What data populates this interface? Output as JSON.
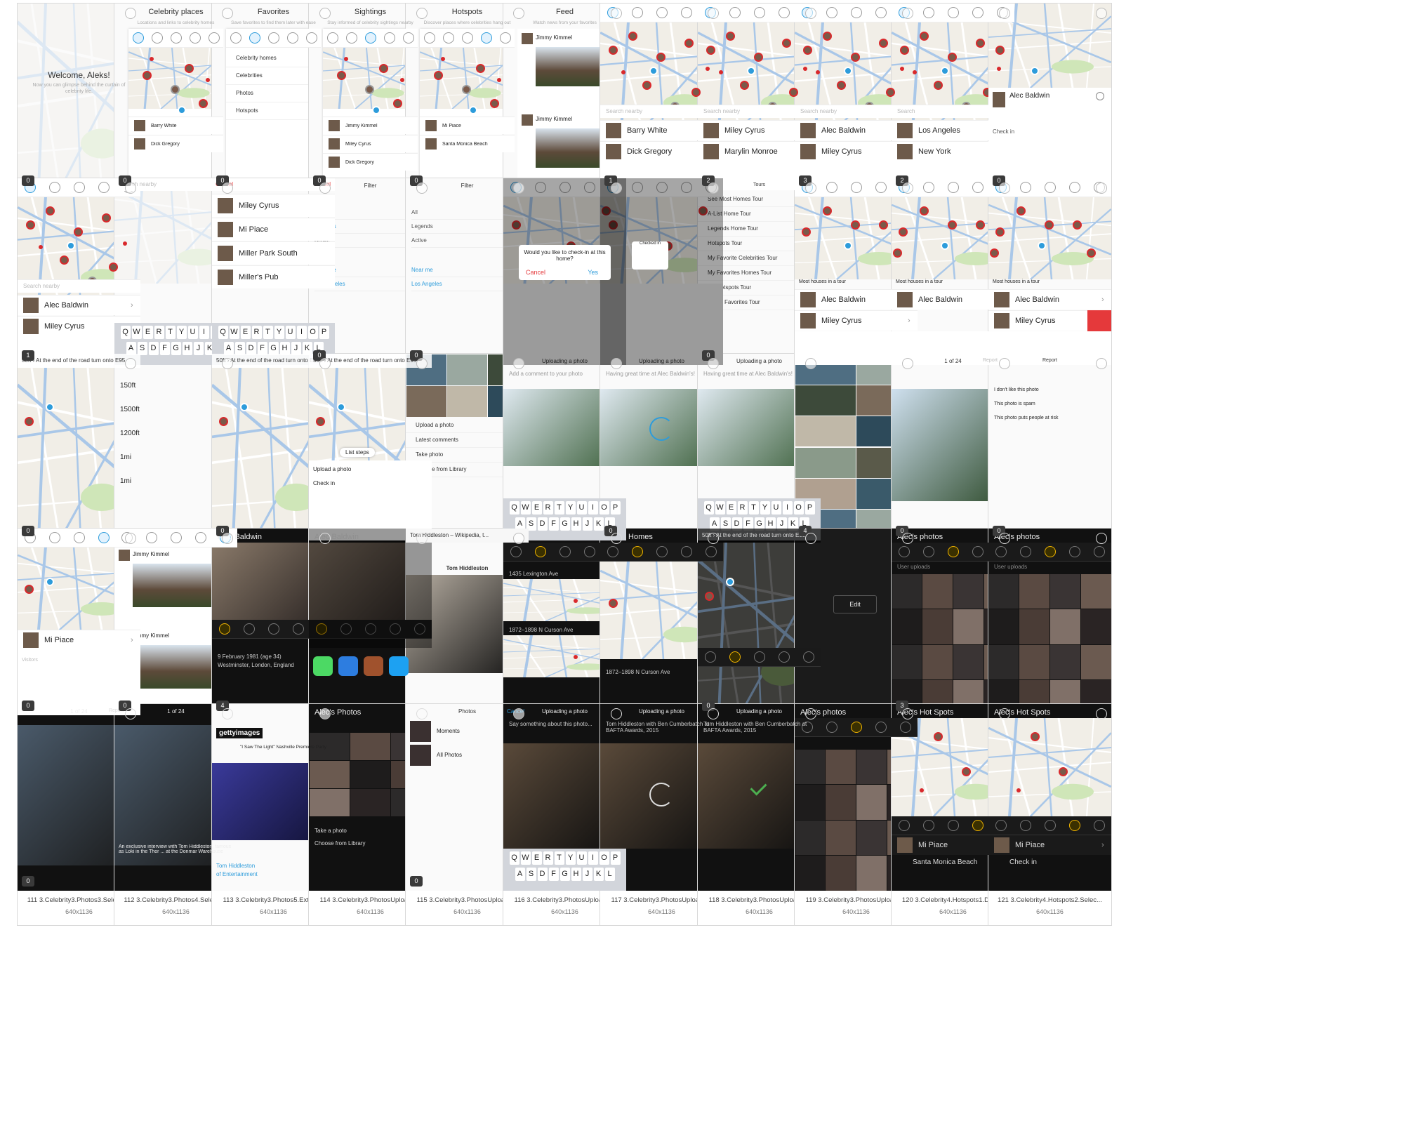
{
  "cards": [
    {
      "caption": "34 1.GeneralOnboarding0.Welco...",
      "dims": "640x1136",
      "badge": "0",
      "kind": "welcome",
      "title": "Welcome, Aleks!",
      "subtitle": "Now you can glimpse behind the curtain of celebrity life."
    },
    {
      "caption": "35 1.GeneralOnboarding1.Celebr...",
      "dims": "640x1136",
      "badge": "0",
      "kind": "onboard",
      "title": "Celebrity places",
      "subtitle": "Locations and links to celebrity homes",
      "items": [
        "Barry White",
        "Dick Gregory"
      ]
    },
    {
      "caption": "36 1.GeneralOnboarding2.Favori...",
      "dims": "640x1136",
      "badge": "0",
      "kind": "favmenu",
      "title": "Favorites",
      "subtitle": "Save favorites to find them later with ease",
      "items": [
        "Celebrity homes",
        "Celebrities",
        "Photos",
        "Hotspots"
      ]
    },
    {
      "caption": "37 1.GeneralOnboarding3.Sighti...",
      "dims": "640x1136",
      "badge": "0",
      "kind": "onboard",
      "title": "Sightings",
      "subtitle": "Stay informed of celebrity sightings nearby",
      "items": [
        "Jimmy Kimmel",
        "Miley Cyrus",
        "Dick Gregory"
      ]
    },
    {
      "caption": "38 1.GeneralOnboarding4.Hotsp...",
      "dims": "640x1136",
      "badge": "0",
      "kind": "onboard",
      "title": "Hotspots",
      "subtitle": "Discover places where celebrities hang out",
      "items": [
        "Mi Piace",
        "Santa Monica Beach"
      ]
    },
    {
      "caption": "39 1.GeneralOnboarding5.Feed...",
      "dims": "640x1136",
      "badge": "",
      "kind": "feed",
      "title": "Feed",
      "subtitle": "Watch news from your favorites",
      "items": [
        "Jimmy Kimmel",
        "Jimmy Kimmel"
      ]
    },
    {
      "caption": "40 2.User1.Celebrity places1.Def...",
      "dims": "640x1136",
      "badge": "1",
      "kind": "maplist",
      "search": "Search nearby",
      "items": [
        "Barry White",
        "Dick Gregory"
      ]
    },
    {
      "caption": "41 2.User1.Celebrity places2.Zoo...",
      "dims": "640x1136",
      "badge": "2",
      "kind": "maplist",
      "search": "Search nearby",
      "items": [
        "Miley Cyrus",
        "Marylin Monroe"
      ]
    },
    {
      "caption": "42 2.User1.Celebrity places3.Zoo...",
      "dims": "640x1136",
      "badge": "3",
      "kind": "maplist",
      "search": "Search nearby",
      "items": [
        "Alec Baldwin",
        "Miley Cyrus"
      ]
    },
    {
      "caption": "43 2.User1.Celebrity places4.Zoo...",
      "dims": "640x1136",
      "badge": "2",
      "kind": "maplist",
      "search": "Search",
      "items": [
        "Los Angeles",
        "New York"
      ]
    },
    {
      "caption": "44 2.User1.Celebrity places5.Sel...",
      "dims": "640x2990",
      "badge": "0",
      "kind": "mapdetail",
      "items": [
        "Alec Baldwin",
        "Check in"
      ]
    },
    {
      "caption": "45 2.User1.Celebrity places6.Pin...",
      "dims": "640x1136",
      "badge": "1",
      "kind": "maplist",
      "search": "Search nearby",
      "items": [
        "Alec Baldwin",
        "Miley Cyrus"
      ]
    },
    {
      "caption": "46 2.User1.Celebrity placesSearc...",
      "dims": "640x1136",
      "badge": "",
      "kind": "search",
      "search": "Search nearby",
      "cancel": "Cancel"
    },
    {
      "caption": "47 2.User1.Celebrity placesSearc...",
      "dims": "640x1136",
      "badge": "",
      "kind": "searchres",
      "search": "Mi",
      "cancel": "Cancel",
      "items": [
        "Miley Cyrus",
        "Mi Piace",
        "Miller Park South",
        "Miller's Pub"
      ]
    },
    {
      "caption": "48 2.User1.Celebrity placesSearc...",
      "dims": "640x1136",
      "badge": "0",
      "kind": "filter",
      "title": "Filter",
      "items": [
        "All",
        "Legends",
        "Active",
        "Near me",
        "Los Angeles"
      ]
    },
    {
      "caption": "49 2.User1.Celebrity placesSearc...",
      "dims": "640x1136",
      "badge": "0",
      "kind": "filter",
      "title": "Filter",
      "items": [
        "All",
        "Legends",
        "Active",
        "Near me",
        "Los Angeles"
      ]
    },
    {
      "caption": "50 2.User1.Celebrity placesChec...",
      "dims": "640x1136",
      "badge": "",
      "kind": "dialog",
      "title": "Would you like to check-in at this home?",
      "items": [
        "Cancel",
        "Yes"
      ]
    },
    {
      "caption": "51 2.User1.Celebrity placesCheck...",
      "dims": "640x1136",
      "badge": "",
      "kind": "checked",
      "title": "Checked in"
    },
    {
      "caption": "52 2.User1.Celebrity placesTours...",
      "dims": "640x1136",
      "badge": "0",
      "kind": "tours",
      "title": "Tours",
      "items": [
        "See Most Homes Tour",
        "A-List Home Tour",
        "Legends Home Tour",
        "Hotspots Tour",
        "My Favorite Celebrities Tour",
        "My Favorites Homes Tour",
        "My Hotspots Tour",
        "All My Favorites Tour"
      ]
    },
    {
      "caption": "53 2.User1.Celebrity placesTours...",
      "dims": "640x1136",
      "badge": "",
      "kind": "tourmap",
      "title": "Most houses in a tour",
      "items": [
        "Alec Baldwin",
        "Miley Cyrus"
      ]
    },
    {
      "caption": "54 2.User1.Celebrity placesTours...",
      "dims": "640x1136",
      "badge": "",
      "kind": "tourmap",
      "title": "Most houses in a tour",
      "items": [
        "Alec Baldwin"
      ]
    },
    {
      "caption": "55 2.User1.Celebrity placesTours...",
      "dims": "640x1136",
      "badge": "",
      "kind": "tourmap",
      "title": "Most houses in a tour",
      "items": [
        "Alec Baldwin",
        "Miley Cyrus"
      ]
    },
    {
      "caption": "56 2.User1.Celebrity placesDirec...",
      "dims": "640x1136",
      "badge": "0",
      "kind": "dirmap",
      "title": "50ft › At the end of the road turn onto E95"
    },
    {
      "caption": "57 2.User1.Celebrity placesDirec...",
      "dims": "640x1136",
      "badge": "",
      "kind": "steps",
      "items": [
        "150ft",
        "1500ft",
        "1200ft",
        "1mi",
        "1mi"
      ]
    },
    {
      "caption": "58 2.User1.Celebrity placesDirec...",
      "dims": "640x1136",
      "badge": "0",
      "kind": "dirmap",
      "title": "50ft › At the end of the road turn onto E95"
    },
    {
      "caption": "59 2.User1.Celebrity placesDirec...",
      "dims": "640x1136",
      "badge": "",
      "kind": "dirmap2",
      "title": "50ft › At the end of the road turn onto E95",
      "items": [
        "List steps",
        "Upload a photo",
        "Check in"
      ]
    },
    {
      "caption": "60 2.User1.Celebrity placesPhot...",
      "dims": "640x1136",
      "badge": "",
      "kind": "photomenu",
      "items": [
        "Upload a photo",
        "Latest comments",
        "Take photo",
        "Choose from Library"
      ]
    },
    {
      "caption": "61 2.User1.Celebrity placesPhoto...",
      "dims": "640x1136",
      "badge": "",
      "kind": "upload",
      "title": "Uploading a photo",
      "items": [
        "Add a comment to your photo"
      ]
    },
    {
      "caption": "62 2.User1.Celebrity placesPhot...",
      "dims": "640x1136",
      "badge": "0",
      "kind": "uploading",
      "title": "Uploading a photo",
      "items": [
        "Having great time at Alec Baldwin's!"
      ]
    },
    {
      "caption": "63 2.User1.Celebrity placesPhot...",
      "dims": "640x1136",
      "badge": "",
      "kind": "upload",
      "title": "Uploading a photo",
      "items": [
        "Having great time at Alec Baldwin's!"
      ]
    },
    {
      "caption": "64 2.User1.Celebrity placesPhot...",
      "dims": "640x1136",
      "badge": "4",
      "kind": "gallery"
    },
    {
      "caption": "65 2.User1.Celebrity placesPhot...",
      "dims": "640x1136",
      "badge": "0",
      "kind": "viewer",
      "title": "1 of 24",
      "items": [
        "Report"
      ]
    },
    {
      "caption": "66 2.User1.Celebrity placesPhot...",
      "dims": "640x1136",
      "badge": "0",
      "kind": "report",
      "title": "Report",
      "items": [
        "I don't like this photo",
        "This photo is spam",
        "This photo puts people at risk"
      ]
    },
    {
      "caption": "100 2.User4.Hotspots2.Selected...",
      "dims": "640x1475",
      "badge": "0",
      "kind": "hotspotmap",
      "items": [
        "Mi Piace",
        "Visitors"
      ]
    },
    {
      "caption": "101 2.User5.Feed1.Default.png",
      "dims": "640x4957",
      "badge": "0",
      "kind": "feed2",
      "items": [
        "Jimmy Kimmel",
        "Jimmy Kimmel"
      ]
    },
    {
      "caption": "102 3.Celebrity1.About1.Default...",
      "dims": "640x2624",
      "badge": "4",
      "kind": "celebabout",
      "title": "Alec Baldwin",
      "items": [
        "9 February 1981 (age 34)",
        "Westminster, London, England"
      ]
    },
    {
      "caption": "103 3.Celebrity1.About2.Share.p...",
      "dims": "640x1136",
      "badge": "",
      "kind": "share",
      "title": "Alec Baldwin"
    },
    {
      "caption": "104 3.Celebrity1.About3.Wikiped...",
      "dims": "640x1136",
      "badge": "",
      "kind": "wiki",
      "title": "Tom Hiddleston",
      "items": [
        "Tom Hiddleston – Wikipedia, t...",
        "Tom Hiddleston"
      ]
    },
    {
      "caption": "105 3.Celebrity2.Places1.Default...",
      "dims": "640x1136",
      "badge": "",
      "kind": "homes",
      "title": "Alec's Homes",
      "items": [
        "1435 Lexington Ave",
        "1872–1898 N Curson Ave"
      ]
    },
    {
      "caption": "106 3.Celebrity2.Places2.Selecte...",
      "dims": "640x1136",
      "badge": "",
      "kind": "homes2",
      "title": "Alec's Homes",
      "items": [
        "1872–1898 N Curson Ave"
      ]
    },
    {
      "caption": "107 3.Celebrity2.PlacesDirection...",
      "dims": "640x1136",
      "badge": "0",
      "kind": "darkdir",
      "title": "50ft › At the end of the road turn onto E95"
    },
    {
      "caption": "108 3.Celebrity2.PlacesDirection...",
      "dims": "640x1136",
      "badge": "",
      "kind": "edit",
      "items": [
        "Edit"
      ]
    },
    {
      "caption": "109 3.Celebrity3.Photos1.Default...",
      "dims": "640x3214",
      "badge": "3",
      "kind": "photos",
      "title": "Alec's photos",
      "items": [
        "User uploads"
      ]
    },
    {
      "caption": "110 3.Celebrity3.Photos2.Group...",
      "dims": "640x1136",
      "badge": "",
      "kind": "photos",
      "title": "Alec's photos",
      "items": [
        "User uploads"
      ]
    },
    {
      "caption": "111 3.Celebrity3.Photos3.Selecte...",
      "dims": "640x1136",
      "badge": "0",
      "kind": "portrait",
      "title": "1 of 24",
      "items": [
        "Report"
      ]
    },
    {
      "caption": "112 3.Celebrity3.Photos4.Selecte...",
      "dims": "640x1136",
      "badge": "",
      "kind": "portrait2",
      "title": "1 of 24",
      "items": [
        "An exclusive interview with Tom Hiddleston, famous as Loki in the Thor ... at the Donmar Warehouse"
      ]
    },
    {
      "caption": "113 3.Celebrity3.Photos5.Extern...",
      "dims": "640x1136",
      "badge": "",
      "kind": "getty",
      "title": "gettyimages",
      "items": [
        "\"I Saw The Light\" Nashville Premiere Party",
        "Tom Hiddleston",
        "of Entertainment"
      ]
    },
    {
      "caption": "114 3.Celebrity3.PhotosUpload0...",
      "dims": "640x1136",
      "badge": "",
      "kind": "darkmenu",
      "title": "Alec's Photos",
      "items": [
        "Take a photo",
        "Choose from Library"
      ]
    },
    {
      "caption": "115 3.Celebrity3.PhotosUpload1...",
      "dims": "640x1136",
      "badge": "0",
      "kind": "albums",
      "title": "Photos",
      "cancel": "Cancel",
      "items": [
        "Moments",
        "All Photos"
      ]
    },
    {
      "caption": "116 3.Celebrity3.PhotosUpload2...",
      "dims": "640x1136",
      "badge": "",
      "kind": "darkupload",
      "title": "Uploading a photo",
      "items": [
        "Say something about this photo..."
      ]
    },
    {
      "caption": "117 3.Celebrity3.PhotosUpload3...",
      "dims": "640x1136",
      "badge": "",
      "kind": "darkuploading",
      "title": "Uploading a photo",
      "items": [
        "Tom Hiddleston with Ben Cumberbatch at BAFTA Awards, 2015"
      ]
    },
    {
      "caption": "118 3.Celebrity3.PhotosUpload4...",
      "dims": "640x1136",
      "badge": "",
      "kind": "darkuploaded",
      "title": "Uploading a photo",
      "items": [
        "Tom Hiddleston with Ben Cumberbatch at BAFTA Awards, 2015"
      ]
    },
    {
      "caption": "119 3.Celebrity3.PhotosUpload5...",
      "dims": "640x1136",
      "badge": "",
      "kind": "photos2",
      "title": "Alec's photos"
    },
    {
      "caption": "120 3.Celebrity4.Hotspots1.Defa...",
      "dims": "640x1136",
      "badge": "",
      "kind": "hotspots",
      "title": "Alec's Hot Spots",
      "items": [
        "Mi Piace",
        "Santa Monica Beach"
      ]
    },
    {
      "caption": "121 3.Celebrity4.Hotspots2.Selec...",
      "dims": "640x1136",
      "badge": "",
      "kind": "hotspots2",
      "title": "Alec's Hot Spots",
      "items": [
        "Mi Piace",
        "Check in"
      ]
    }
  ]
}
